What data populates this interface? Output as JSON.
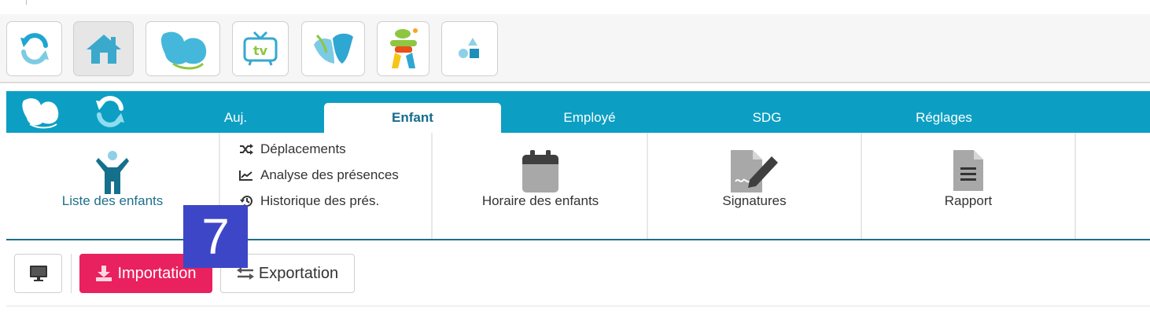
{
  "launcher": {
    "apps": [
      {
        "icon": "refresh-icon"
      },
      {
        "icon": "home-icon"
      },
      {
        "icon": "butterfly-logo-icon"
      },
      {
        "icon": "tv-icon"
      },
      {
        "icon": "butterfly-blue-icon"
      },
      {
        "icon": "figure-app-icon"
      },
      {
        "icon": "shapes-icon"
      }
    ]
  },
  "tabs": {
    "items": [
      {
        "label": "Auj."
      },
      {
        "label": "Enfant",
        "active": true
      },
      {
        "label": "Employé"
      },
      {
        "label": "SDG"
      },
      {
        "label": "Réglages"
      }
    ]
  },
  "ribbon": {
    "children_list": "Liste des enfants",
    "moves": "Déplacements",
    "attendance_analysis": "Analyse des présences",
    "attendance_history": "Historique des prés.",
    "schedule": "Horaire des enfants",
    "signatures": "Signatures",
    "report": "Rapport"
  },
  "toolbar": {
    "import_label": "Importation",
    "export_label": "Exportation"
  },
  "overlay": {
    "step_number": "7"
  },
  "colors": {
    "tab_bar": "#0c9fc3",
    "import_button": "#e9215f",
    "badge": "#3e46c8"
  }
}
